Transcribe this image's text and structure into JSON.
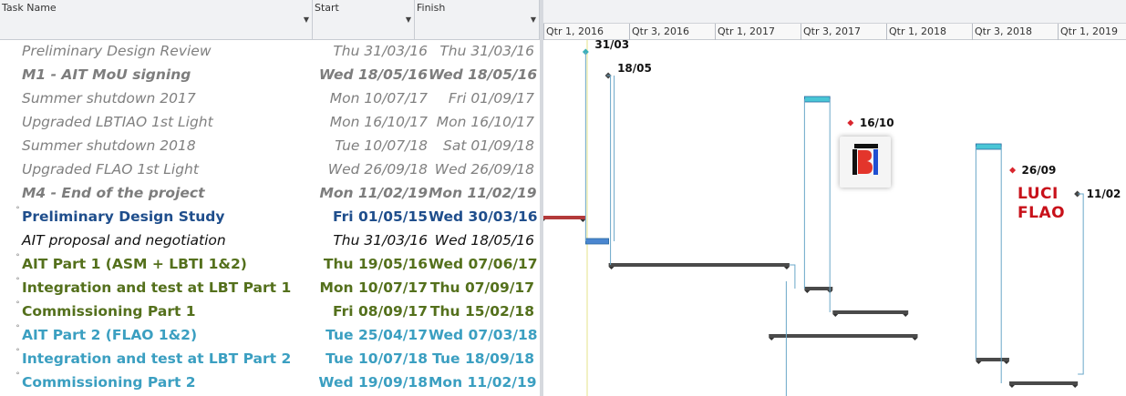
{
  "columns": {
    "name": "Task Name",
    "start": "Start",
    "finish": "Finish"
  },
  "timescale": [
    "Qtr 1, 2016",
    "Qtr 3, 2016",
    "Qtr 1, 2017",
    "Qtr 3, 2017",
    "Qtr 1, 2018",
    "Qtr 3, 2018",
    "Qtr 1, 2019"
  ],
  "tasks": [
    {
      "name": "Preliminary Design Review",
      "start": "Thu 31/03/16",
      "finish": "Thu 31/03/16",
      "style": "ms",
      "summary": false
    },
    {
      "name": "M1 - AIT MoU signing",
      "start": "Wed 18/05/16",
      "finish": "Wed 18/05/16",
      "style": "msb",
      "summary": false
    },
    {
      "name": "Summer shutdown 2017",
      "start": "Mon 10/07/17",
      "finish": "Fri 01/09/17",
      "style": "ms",
      "summary": false
    },
    {
      "name": "Upgraded LBTIAO 1st Light",
      "start": "Mon 16/10/17",
      "finish": "Mon 16/10/17",
      "style": "ms",
      "summary": false
    },
    {
      "name": "Summer shutdown 2018",
      "start": "Tue 10/07/18",
      "finish": "Sat 01/09/18",
      "style": "ms",
      "summary": false
    },
    {
      "name": "Upgraded FLAO 1st Light",
      "start": "Wed 26/09/18",
      "finish": "Wed 26/09/18",
      "style": "ms",
      "summary": false
    },
    {
      "name": "M4 - End of the project",
      "start": "Mon 11/02/19",
      "finish": "Mon 11/02/19",
      "style": "msb",
      "summary": false
    },
    {
      "name": "Preliminary Design Study",
      "start": "Fri 01/05/15",
      "finish": "Wed 30/03/16",
      "style": "sum-blue",
      "summary": true
    },
    {
      "name": "AIT proposal and negotiation",
      "start": "Thu 31/03/16",
      "finish": "Wed 18/05/16",
      "style": "task",
      "summary": false
    },
    {
      "name": "AIT Part 1 (ASM + LBTI 1&2)",
      "start": "Thu 19/05/16",
      "finish": "Wed 07/06/17",
      "style": "sum-green",
      "summary": true
    },
    {
      "name": "Integration and test at LBT Part 1",
      "start": "Mon 10/07/17",
      "finish": "Thu 07/09/17",
      "style": "sum-green",
      "summary": true
    },
    {
      "name": "Commissioning Part 1",
      "start": "Fri 08/09/17",
      "finish": "Thu 15/02/18",
      "style": "sum-green",
      "summary": true
    },
    {
      "name": "AIT Part 2 (FLAO 1&2)",
      "start": "Tue 25/04/17",
      "finish": "Wed 07/03/18",
      "style": "sum-cyan",
      "summary": true
    },
    {
      "name": "Integration and test at LBT Part 2",
      "start": "Tue 10/07/18",
      "finish": "Tue 18/09/18",
      "style": "sum-cyan",
      "summary": true
    },
    {
      "name": "Commissioning Part 2",
      "start": "Wed 19/09/18",
      "finish": "Mon 11/02/19",
      "style": "sum-cyan",
      "summary": true
    }
  ],
  "milestone_labels": [
    "31/03",
    "18/05",
    "16/10",
    "26/09",
    "11/02"
  ],
  "logos": {
    "bti_letters": "BTI",
    "luci_line1": "LUCI",
    "luci_line2": "FLAO"
  },
  "colors": {
    "summary_blue": "#1f4e8c",
    "summary_green": "#54701c",
    "summary_cyan": "#3b9fc1",
    "milestone_gray": "#808080",
    "milestone_red": "#d9262e",
    "shutdown_bar": "#49c6d6",
    "logo_red": "#c8111a"
  }
}
